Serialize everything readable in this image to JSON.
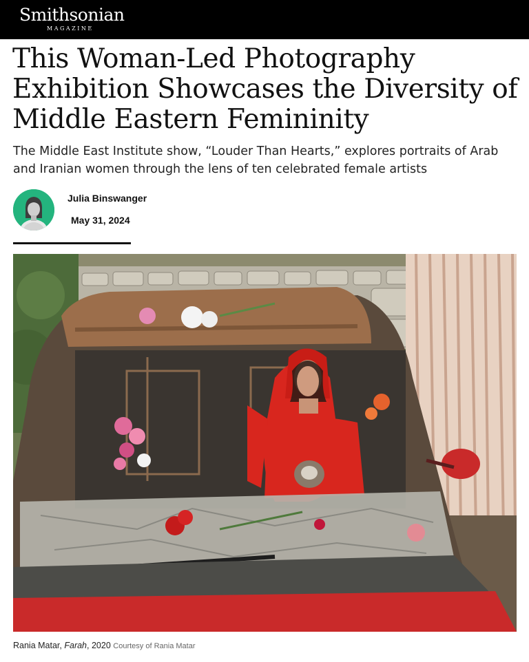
{
  "site": {
    "logo_main": "Smithsonian",
    "logo_sub": "MAGAZINE"
  },
  "article": {
    "headline": "This Woman-Led Photography Exhibition Showcases the Diversity of Middle Eastern Femininity",
    "dek": "The Middle East Institute show, “Louder Than Hearts,” explores portraits of Arab and Iranian women through the lens of ten celebrated female artists",
    "author": "Julia Binswanger",
    "date": "May 31, 2024"
  },
  "image": {
    "caption_artist": "Rania Matar,",
    "caption_title": "Farah",
    "caption_year": ", 2020",
    "caption_credit": "Courtesy of Rania Matar"
  },
  "colors": {
    "topbar": "#000000",
    "avatar_bg": "#24b47e",
    "dress_red": "#d8261e",
    "car_red": "#c92a2a"
  }
}
